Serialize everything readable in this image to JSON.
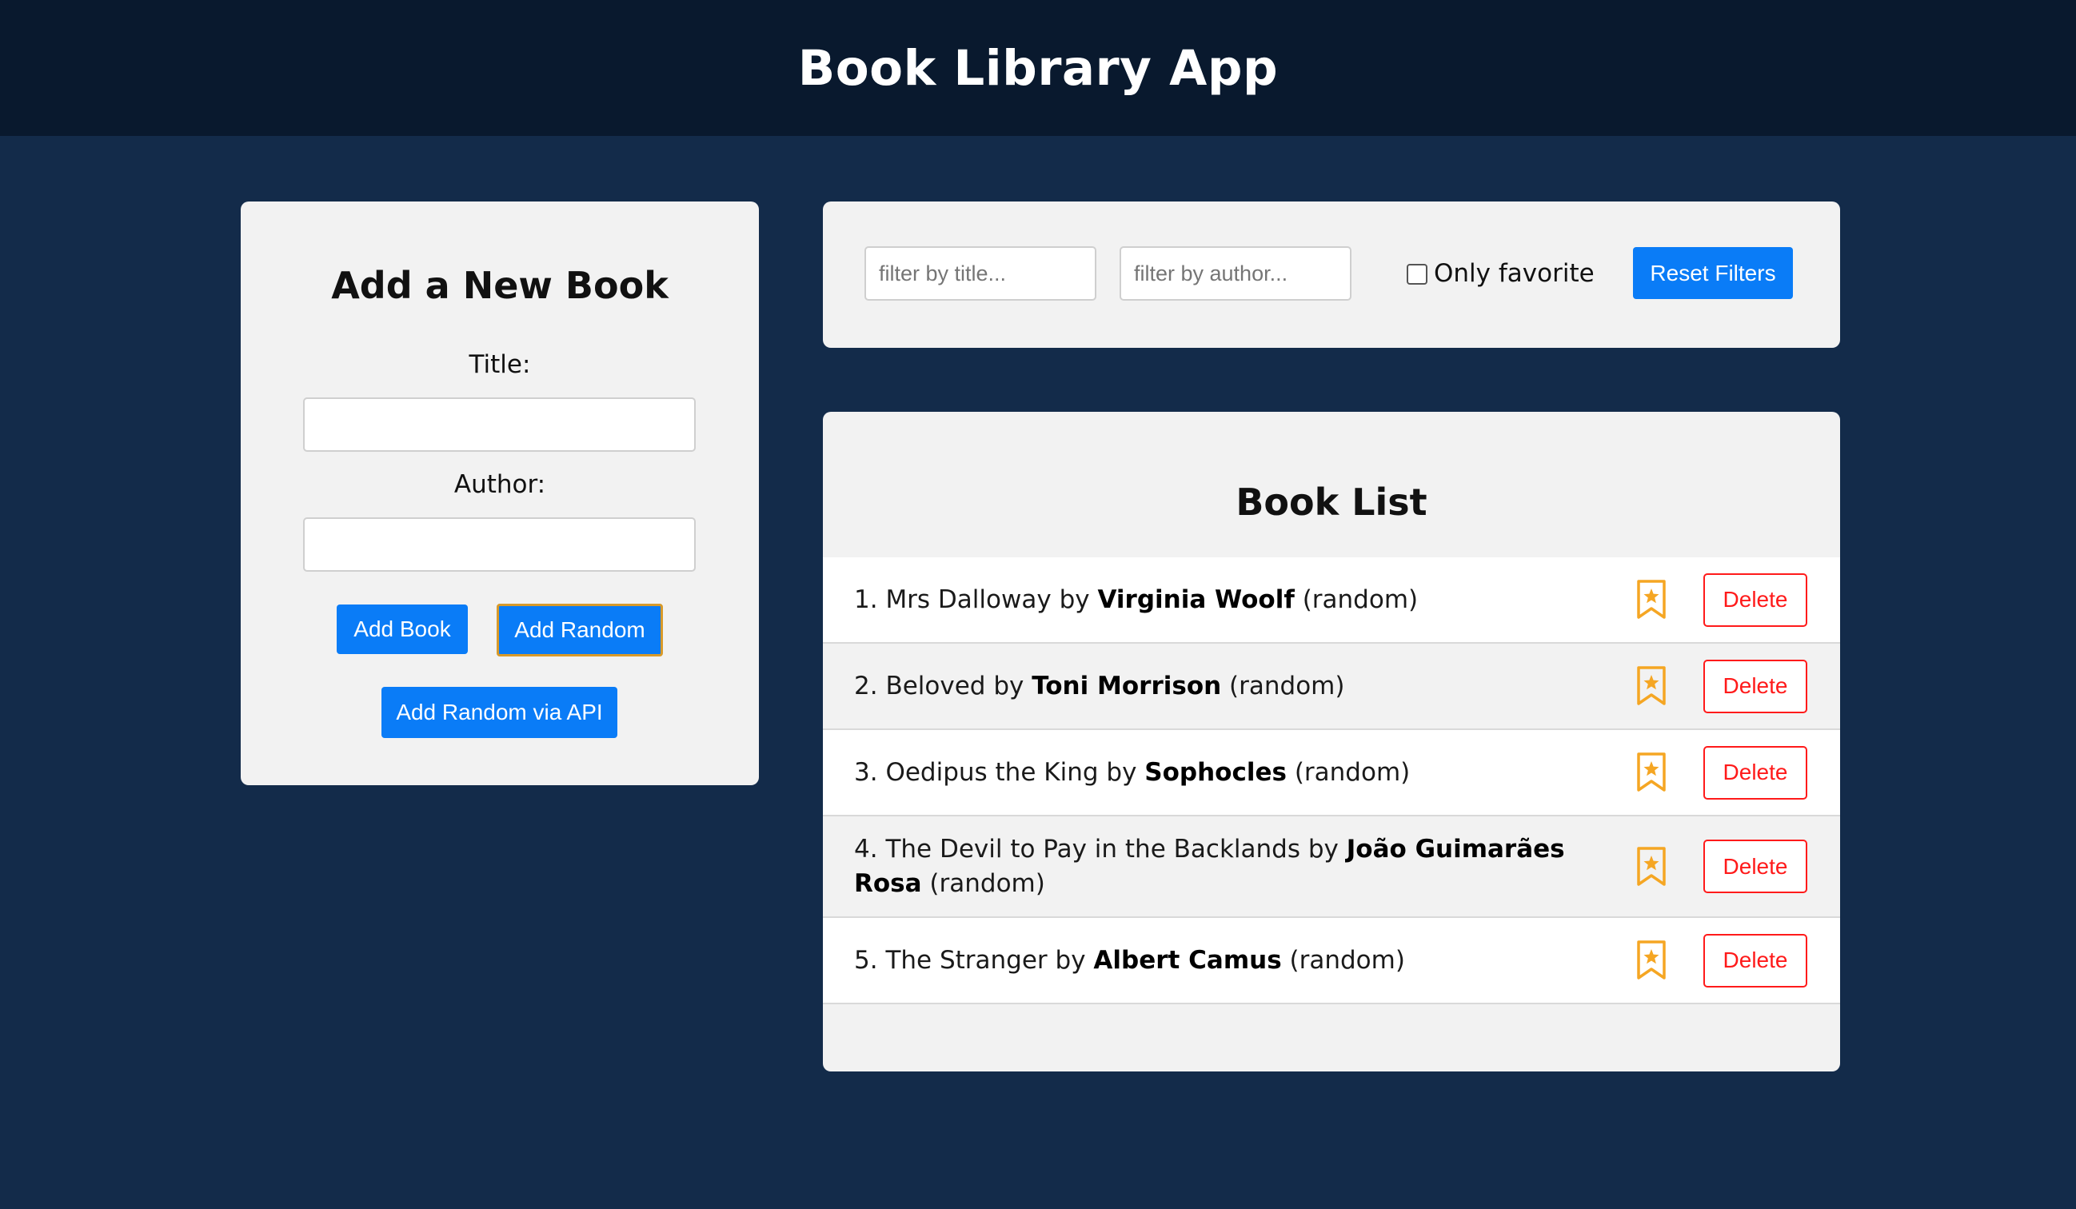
{
  "app": {
    "title": "Book Library App"
  },
  "add_form": {
    "heading": "Add a New Book",
    "title_label": "Title:",
    "title_value": "",
    "author_label": "Author:",
    "author_value": "",
    "add_book_label": "Add Book",
    "add_random_label": "Add Random",
    "add_random_api_label": "Add Random via API"
  },
  "filters": {
    "title_placeholder": "filter by title...",
    "author_placeholder": "filter by author...",
    "only_favorite_label": "Only favorite",
    "only_favorite_checked": false,
    "reset_label": "Reset Filters"
  },
  "book_list": {
    "heading": "Book List",
    "delete_label": "Delete",
    "favorite_icon": "bookmark-star-icon",
    "items": [
      {
        "index": "1.",
        "title": "Mrs Dalloway",
        "by": "by",
        "author": "Virginia Woolf",
        "source": "(random)"
      },
      {
        "index": "2.",
        "title": "Beloved",
        "by": "by",
        "author": "Toni Morrison",
        "source": "(random)"
      },
      {
        "index": "3.",
        "title": "Oedipus the King",
        "by": "by",
        "author": "Sophocles",
        "source": "(random)"
      },
      {
        "index": "4.",
        "title": "The Devil to Pay in the Backlands",
        "by": "by",
        "author": "João Guimarães Rosa",
        "source": "(random)"
      },
      {
        "index": "5.",
        "title": "The Stranger",
        "by": "by",
        "author": "Albert Camus",
        "source": "(random)"
      }
    ]
  },
  "colors": {
    "background": "#132b4a",
    "header": "#09192e",
    "primary": "#0a7cf7",
    "danger": "#ff1a1a",
    "favorite": "#f5a623",
    "card": "#f2f2f2"
  }
}
